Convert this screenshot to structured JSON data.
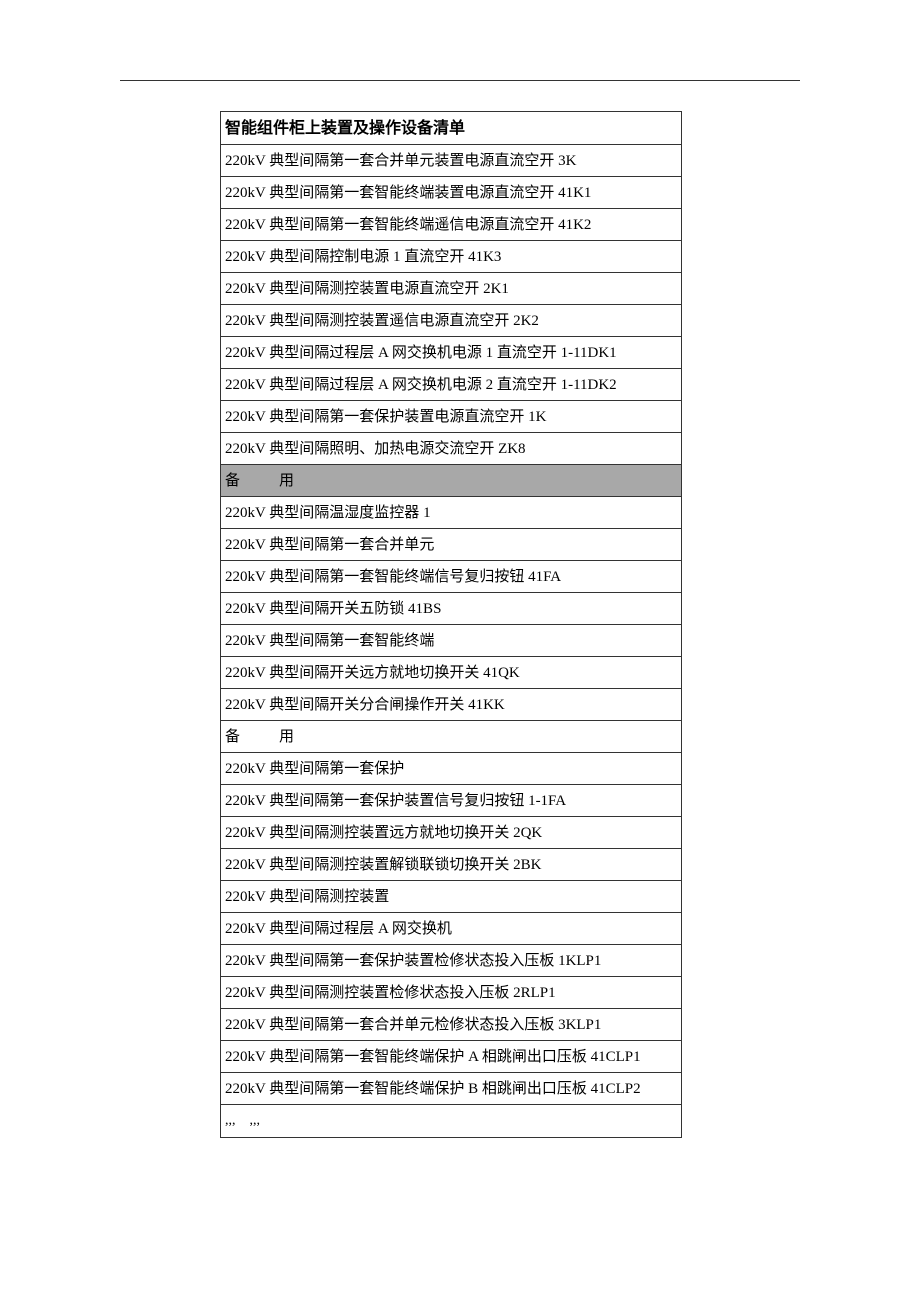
{
  "table": {
    "header": "智能组件柜上装置及操作设备清单",
    "rows": [
      {
        "text": "220kV 典型间隔第一套合并单元装置电源直流空开 3K",
        "shaded": false
      },
      {
        "text": "220kV 典型间隔第一套智能终端装置电源直流空开 41K1",
        "shaded": false
      },
      {
        "text": "220kV 典型间隔第一套智能终端遥信电源直流空开 41K2",
        "shaded": false
      },
      {
        "text": "220kV 典型间隔控制电源 1 直流空开 41K3",
        "shaded": false
      },
      {
        "text": "220kV 典型间隔测控装置电源直流空开 2K1",
        "shaded": false
      },
      {
        "text": "220kV 典型间隔测控装置遥信电源直流空开 2K2",
        "shaded": false
      },
      {
        "text": "220kV 典型间隔过程层 A 网交换机电源 1 直流空开 1-11DK1",
        "shaded": false
      },
      {
        "text": "220kV 典型间隔过程层 A 网交换机电源 2 直流空开 1-11DK2",
        "shaded": false
      },
      {
        "text": "220kV 典型间隔第一套保护装置电源直流空开 1K",
        "shaded": false
      },
      {
        "text": "220kV 典型间隔照明、加热电源交流空开 ZK8",
        "shaded": false
      },
      {
        "text": "备 用",
        "shaded": true,
        "spare": true
      },
      {
        "text": "220kV 典型间隔温湿度监控器 1",
        "shaded": false
      },
      {
        "text": "220kV 典型间隔第一套合并单元",
        "shaded": false
      },
      {
        "text": "220kV 典型间隔第一套智能终端信号复归按钮 41FA",
        "shaded": false
      },
      {
        "text": "220kV 典型间隔开关五防锁 41BS",
        "shaded": false
      },
      {
        "text": "220kV 典型间隔第一套智能终端",
        "shaded": false
      },
      {
        "text": "220kV 典型间隔开关远方就地切换开关 41QK",
        "shaded": false
      },
      {
        "text": "220kV 典型间隔开关分合闸操作开关 41KK",
        "shaded": false
      },
      {
        "text": "备 用",
        "shaded": false,
        "spare": true
      },
      {
        "text": "220kV 典型间隔第一套保护",
        "shaded": false
      },
      {
        "text": "220kV 典型间隔第一套保护装置信号复归按钮 1-1FA",
        "shaded": false
      },
      {
        "text": "220kV 典型间隔测控装置远方就地切换开关 2QK",
        "shaded": false
      },
      {
        "text": "220kV 典型间隔测控装置解锁联锁切换开关 2BK",
        "shaded": false
      },
      {
        "text": "220kV 典型间隔测控装置",
        "shaded": false
      },
      {
        "text": "220kV 典型间隔过程层 A 网交换机",
        "shaded": false
      },
      {
        "text": "220kV 典型间隔第一套保护装置检修状态投入压板 1KLP1",
        "shaded": false
      },
      {
        "text": "220kV 典型间隔测控装置检修状态投入压板 2RLP1",
        "shaded": false
      },
      {
        "text": "220kV 典型间隔第一套合并单元检修状态投入压板 3KLP1",
        "shaded": false
      },
      {
        "text": "220kV 典型间隔第一套智能终端保护 A 相跳闸出口压板 41CLP1",
        "shaded": false
      },
      {
        "text": "220kV 典型间隔第一套智能终端保护 B 相跳闸出口压板 41CLP2",
        "shaded": false
      }
    ],
    "trailing": ",,, ,,,"
  }
}
